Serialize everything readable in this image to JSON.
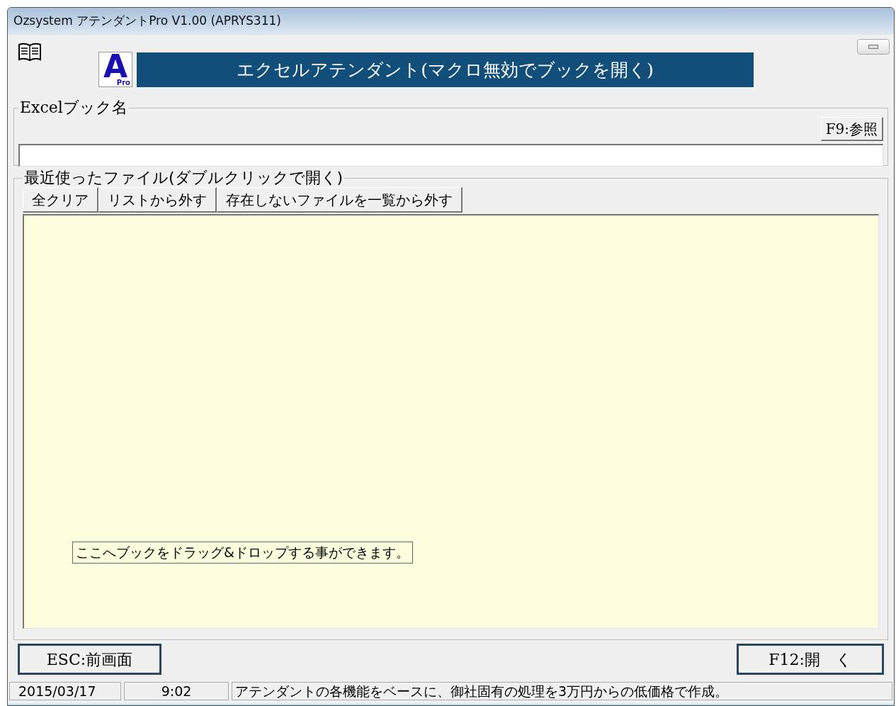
{
  "window": {
    "title": "Ozsystem アテンダントPro V1.00 (APRYS311)"
  },
  "logo": {
    "letter": "A",
    "sub": "Pro"
  },
  "banner": {
    "text": "エクセルアテンダント(マクロ無効でブックを開く)"
  },
  "book_group": {
    "label": "Excelブック名",
    "browse_button": "F9:参照"
  },
  "recent_group": {
    "label": "最近使ったファイル(ダブルクリックで開く)",
    "buttons": [
      "全クリア",
      "リストから外す",
      "存在しないファイルを一覧から外す"
    ],
    "hint": "ここへブックをドラッグ&ドロップする事ができます。"
  },
  "footer_buttons": {
    "back": "ESC:前画面",
    "open": "F12:開　く"
  },
  "status_bar": {
    "date": "2015/03/17",
    "time": "9:02",
    "message": "アテンダントの各機能をベースに、御社固有の処理を3万円からの低価格で作成。"
  }
}
